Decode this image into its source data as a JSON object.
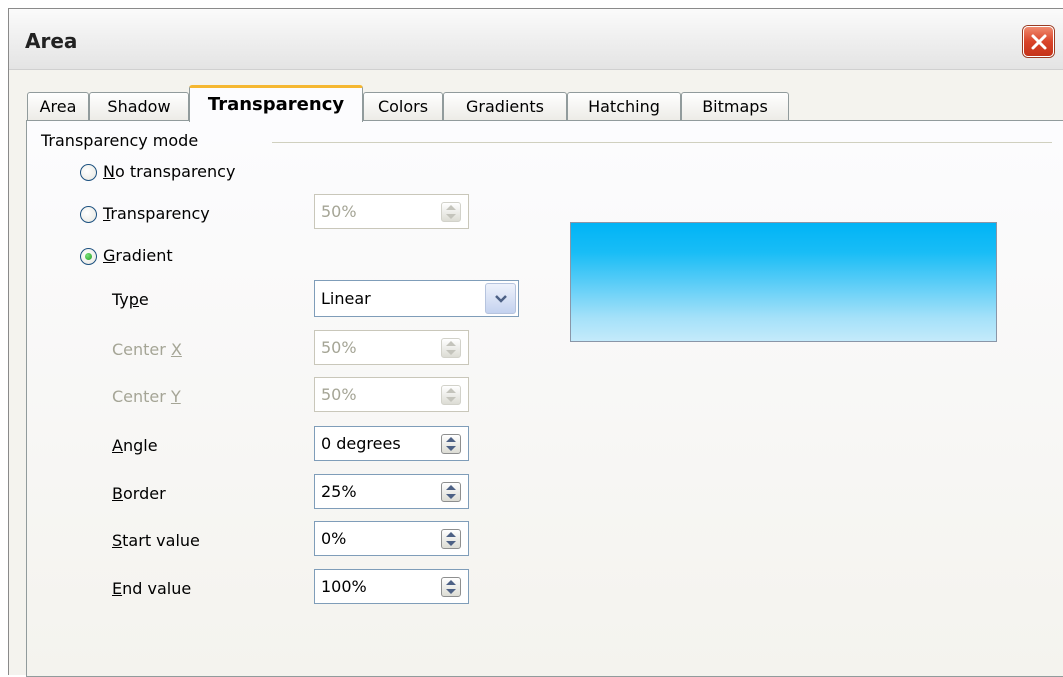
{
  "window": {
    "title": "Area"
  },
  "tabs": [
    {
      "label": "Area",
      "active": false
    },
    {
      "label": "Shadow",
      "active": false
    },
    {
      "label": "Transparency",
      "active": true
    },
    {
      "label": "Colors",
      "active": false
    },
    {
      "label": "Gradients",
      "active": false
    },
    {
      "label": "Hatching",
      "active": false
    },
    {
      "label": "Bitmaps",
      "active": false
    }
  ],
  "transparency_mode": {
    "group_label": "Transparency mode",
    "options": {
      "no_transparency": {
        "label_key": "N",
        "label_rest": "o transparency",
        "selected": false
      },
      "transparency": {
        "label_key": "T",
        "label_rest": "ransparency",
        "selected": false,
        "value": "50%"
      },
      "gradient": {
        "label_key": "G",
        "label_rest": "radient",
        "selected": true
      }
    }
  },
  "gradient": {
    "type": {
      "label_pre": "Ty",
      "label_key": "p",
      "label_post": "e",
      "value": "Linear"
    },
    "center_x": {
      "label_pre": "Center ",
      "label_key": "X",
      "value": "50%",
      "enabled": false
    },
    "center_y": {
      "label_pre": "Center ",
      "label_key": "Y",
      "value": "50%",
      "enabled": false
    },
    "angle": {
      "label_key": "A",
      "label_rest": "ngle",
      "value": "0 degrees"
    },
    "border": {
      "label_key": "B",
      "label_rest": "order",
      "value": "25%"
    },
    "start_value": {
      "label_key": "S",
      "label_rest": "tart value",
      "value": "0%"
    },
    "end_value": {
      "label_key": "E",
      "label_rest": "nd value",
      "value": "100%"
    }
  },
  "preview": {
    "gradient_top": "#00b4f6",
    "gradient_bottom": "#c4eafb"
  },
  "colors": {
    "accent_tab": "#f5b731",
    "close_button": "#d9442a"
  },
  "icons": [
    "close-icon",
    "chevron-down-icon",
    "spin-up-icon",
    "spin-down-icon"
  ]
}
